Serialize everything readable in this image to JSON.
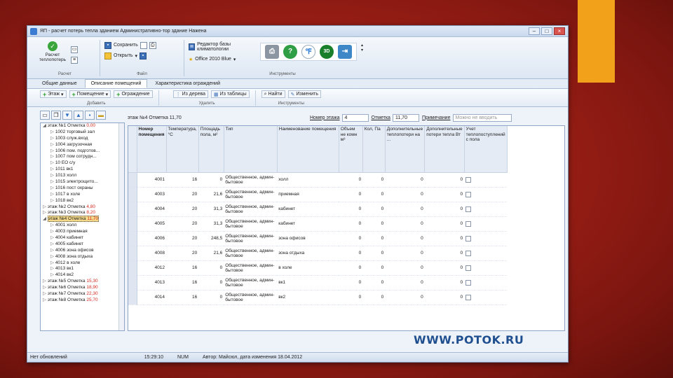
{
  "window": {
    "title": "ЯП - расчет потерь тепла зданием Административно-тор здание Нажена"
  },
  "ribbon": {
    "raschet": {
      "label": "Расчет теплопотерь",
      "group": "Расчет"
    },
    "file": {
      "save": "Сохранить",
      "open": "Открыть",
      "group": "Файл"
    },
    "tools": {
      "db_editor": "Редактор базы климатологии",
      "theme": "Office 2010 Blue",
      "group": "Инструменты"
    }
  },
  "tabs": [
    "Общие данные",
    "Описание помещений",
    "Характеристика ограждений"
  ],
  "subribbon": {
    "add": {
      "floor": "Этаж",
      "room": "Помещение",
      "fence": "Ограждение",
      "group": "Добавить"
    },
    "delete": {
      "from_tree": "Из дерева",
      "from_table": "Из таблицы",
      "group": "Удалить"
    },
    "tools": {
      "find": "Найти",
      "change": "Изменить",
      "group": "Инструменты"
    }
  },
  "tree": [
    {
      "label": "этаж №1 Отметка ",
      "elev": "0,00",
      "level": 0,
      "sign": "◢"
    },
    {
      "label": "1002 торговый зал",
      "level": 1
    },
    {
      "label": "1003 служ.вход",
      "level": 1
    },
    {
      "label": "1004 загрузочная",
      "level": 1
    },
    {
      "label": "1006 пом. подготов...",
      "level": 1
    },
    {
      "label": "1007 пом сотрудн...",
      "level": 1
    },
    {
      "label": "10 ЕО с/у",
      "level": 1
    },
    {
      "label": "1011 вк1",
      "level": 1
    },
    {
      "label": "1013 холл",
      "level": 1
    },
    {
      "label": "1015 электрощито...",
      "level": 1
    },
    {
      "label": "1016 пост охраны",
      "level": 1
    },
    {
      "label": "1017 в холе",
      "level": 1
    },
    {
      "label": "1018 вк2",
      "level": 1
    },
    {
      "label": "этаж №2 Отметка ",
      "elev": "4,80",
      "level": 0,
      "sign": "▷"
    },
    {
      "label": "этаж №3 Отметка ",
      "elev": "8,20",
      "level": 0,
      "sign": "▷"
    },
    {
      "label": "этаж №4 Отметка ",
      "elev": "11,70",
      "level": 0,
      "sign": "◢",
      "selected": true
    },
    {
      "label": "4001 холл",
      "level": 1
    },
    {
      "label": "4003 приемная",
      "level": 1
    },
    {
      "label": "4004 кабинет",
      "level": 1
    },
    {
      "label": "4005 кабинет",
      "level": 1
    },
    {
      "label": "4006 зона офисов",
      "level": 1
    },
    {
      "label": "4008 зона отдыха",
      "level": 1
    },
    {
      "label": "4012 в холе",
      "level": 1
    },
    {
      "label": "4013 вк1",
      "level": 1
    },
    {
      "label": "4014 вк2",
      "level": 1
    },
    {
      "label": "этаж №5 Отметка ",
      "elev": "15,30",
      "level": 0,
      "sign": "▷"
    },
    {
      "label": "этаж №6 Отметка ",
      "elev": "18,90",
      "level": 0,
      "sign": "▷"
    },
    {
      "label": "этаж №7 Отметка ",
      "elev": "22,30",
      "level": 0,
      "sign": "▷"
    },
    {
      "label": "этаж №8 Отметка ",
      "elev": "25,70",
      "level": 0,
      "sign": "▷"
    }
  ],
  "floorbar": {
    "title": "этаж №4 Отметка 11,70",
    "floor_num_label": "Номер этажа",
    "floor_num": "4",
    "elev_label": "Отметка",
    "elev": "11,70",
    "note_label": "Примечание",
    "note_placeholder": "Можно не вводить"
  },
  "table": {
    "headers": [
      "Номер помещения",
      "Температура, °C",
      "Площадь пола, м²",
      "Тип",
      "Наименование помещения",
      "Объем не комн м³",
      "Кол, Па",
      "Дополнительные теплопотери на ...",
      "Дополнительные потери тепла Вт",
      "Учет теплопоступлений с пола"
    ],
    "rows": [
      [
        "4001",
        "16",
        "0",
        "Общественное, админ-бытовое",
        "холл",
        "0",
        "0",
        "0",
        "0"
      ],
      [
        "4003",
        "20",
        "21,6",
        "Общественное, админ-бытовое",
        "приемная",
        "0",
        "0",
        "0",
        "0"
      ],
      [
        "4004",
        "20",
        "31,3",
        "Общественное, админ-бытовое",
        "кабинет",
        "0",
        "0",
        "0",
        "0"
      ],
      [
        "4005",
        "20",
        "31,3",
        "Общественное, админ-бытовое",
        "кабинет",
        "0",
        "0",
        "0",
        "0"
      ],
      [
        "4006",
        "20",
        "248,5",
        "Общественное, админ-бытовое",
        "зона офисов",
        "0",
        "0",
        "0",
        "0"
      ],
      [
        "4008",
        "20",
        "21,6",
        "Общественное, админ-бытовое",
        "зона отдыха",
        "0",
        "0",
        "0",
        "0"
      ],
      [
        "4012",
        "16",
        "0",
        "Общественное, админ-бытовое",
        "в холе",
        "0",
        "0",
        "0",
        "0"
      ],
      [
        "4013",
        "16",
        "0",
        "Общественное, админ-бытовое",
        "вк1",
        "0",
        "0",
        "0",
        "0"
      ],
      [
        "4014",
        "16",
        "0",
        "Общественное, админ-бытовое",
        "вк2",
        "0",
        "0",
        "0",
        "0"
      ]
    ]
  },
  "statusbar": {
    "state": "Нет обновлений",
    "time": "15:29:10",
    "num": "NUM",
    "author": "Автор: Майсюл, дата изменения 18.04.2012"
  },
  "watermark": "WWW.POTOK.RU",
  "colors": {
    "accent": "#f2a21a",
    "background": "#9a1f16",
    "elevation": "#d4291f"
  }
}
